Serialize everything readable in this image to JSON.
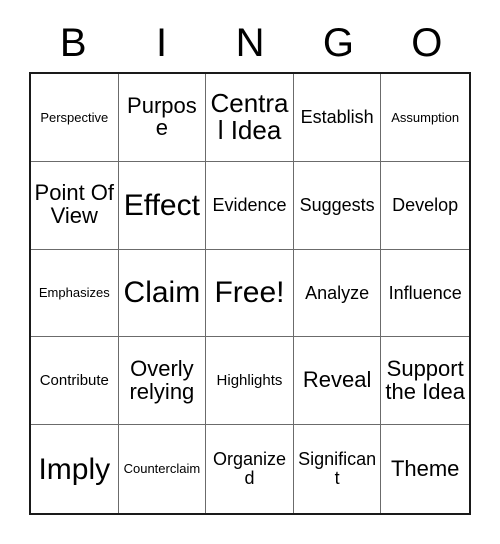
{
  "header": {
    "letters": [
      "B",
      "I",
      "N",
      "G",
      "O"
    ]
  },
  "grid": {
    "rows": [
      [
        {
          "label": "Perspective",
          "size": "fs-xs"
        },
        {
          "label": "Purpose",
          "size": "fs-l"
        },
        {
          "label": "Central Idea",
          "size": "fs-xl"
        },
        {
          "label": "Establish",
          "size": "fs-m"
        },
        {
          "label": "Assumption",
          "size": "fs-xs"
        }
      ],
      [
        {
          "label": "Point Of View",
          "size": "fs-l"
        },
        {
          "label": "Effect",
          "size": "fs-xxl"
        },
        {
          "label": "Evidence",
          "size": "fs-m"
        },
        {
          "label": "Suggests",
          "size": "fs-m"
        },
        {
          "label": "Develop",
          "size": "fs-m"
        }
      ],
      [
        {
          "label": "Emphasizes",
          "size": "fs-xs"
        },
        {
          "label": "Claim",
          "size": "fs-xxl"
        },
        {
          "label": "Free!",
          "size": "fs-xxl"
        },
        {
          "label": "Analyze",
          "size": "fs-m"
        },
        {
          "label": "Influence",
          "size": "fs-m"
        }
      ],
      [
        {
          "label": "Contribute",
          "size": "fs-s"
        },
        {
          "label": "Overly relying",
          "size": "fs-l"
        },
        {
          "label": "Highlights",
          "size": "fs-s"
        },
        {
          "label": "Reveal",
          "size": "fs-l"
        },
        {
          "label": "Support the Idea",
          "size": "fs-l"
        }
      ],
      [
        {
          "label": "Imply",
          "size": "fs-xxl"
        },
        {
          "label": "Counterclaim",
          "size": "fs-xs"
        },
        {
          "label": "Organized",
          "size": "fs-m"
        },
        {
          "label": "Significant",
          "size": "fs-m"
        },
        {
          "label": "Theme",
          "size": "fs-l"
        }
      ]
    ]
  },
  "colors": {
    "outer_border": "#1a1a1a",
    "inner_border": "#6b6b6b",
    "text": "#000000",
    "background": "#ffffff"
  }
}
